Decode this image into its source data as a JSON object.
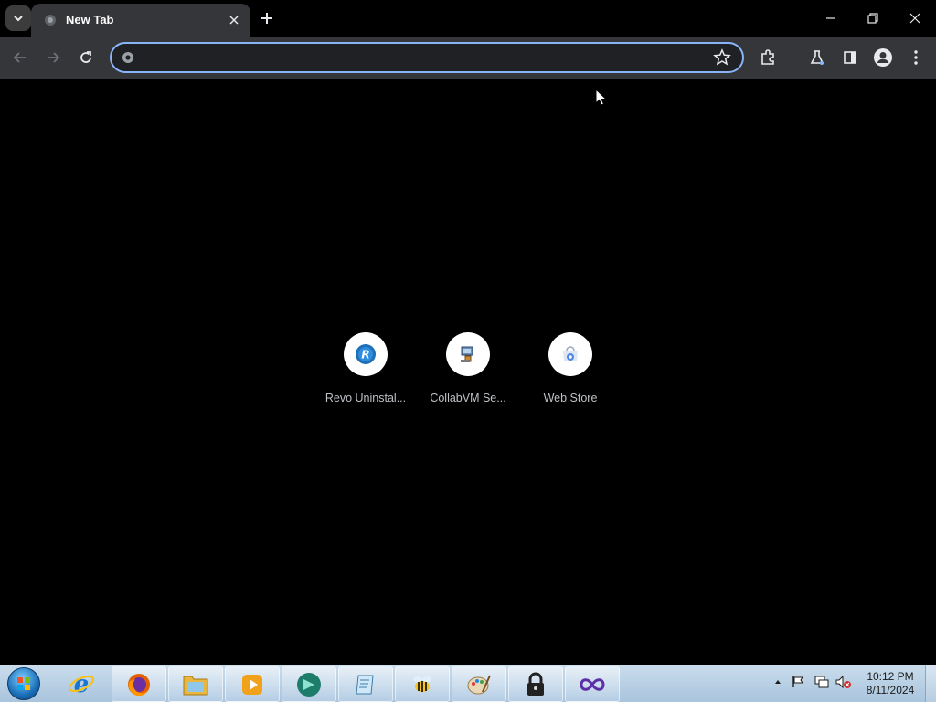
{
  "browser": {
    "tab": {
      "title": "New Tab"
    },
    "omnibox": {
      "value": "",
      "placeholder": ""
    }
  },
  "shortcuts": [
    {
      "label": "Revo Uninstal..."
    },
    {
      "label": "CollabVM Se..."
    },
    {
      "label": "Web Store"
    }
  ],
  "taskbar": {
    "apps": [
      "Internet Explorer",
      "Firefox",
      "Windows Explorer",
      "Media Player",
      "Browser",
      "Notepad",
      "Bee App",
      "Paint",
      "Lock App",
      "Visual Studio"
    ],
    "clock": {
      "time": "10:12 PM",
      "date": "8/11/2024"
    }
  },
  "colors": {
    "accent": "#8ab4f8",
    "toolbar": "#35363a",
    "page": "#000000",
    "taskbar": "#b9d1e6"
  }
}
